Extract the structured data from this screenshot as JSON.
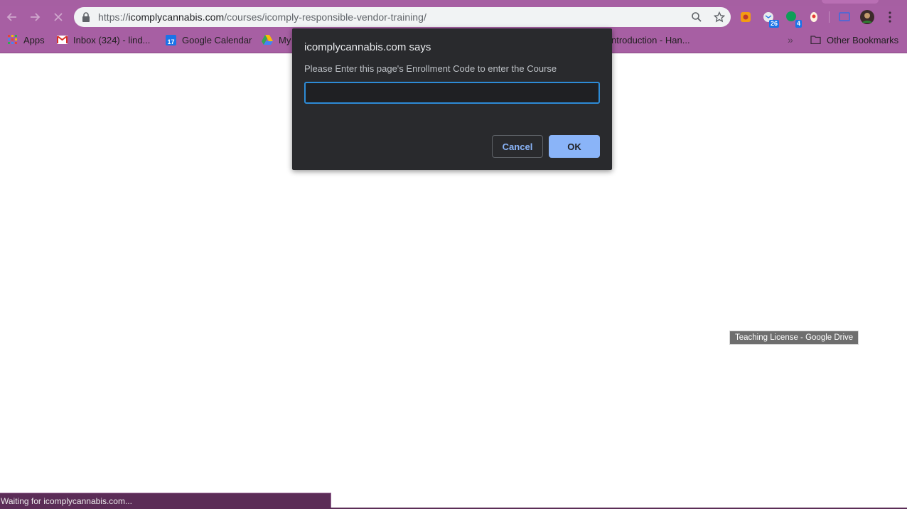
{
  "browser": {
    "url_scheme": "https://",
    "url_host": "icomplycannabis.com",
    "url_path": "/courses/icomply-responsible-vendor-training/",
    "extensions": [
      {
        "name": "honey-extension-icon",
        "badge": ""
      },
      {
        "name": "mail-extension-icon",
        "badge": "26"
      },
      {
        "name": "chat-extension-icon",
        "badge": "4"
      },
      {
        "name": "pin-extension-icon",
        "badge": ""
      }
    ]
  },
  "bookmarks": {
    "apps": "Apps",
    "gmail": "Inbox (324) - lind...",
    "calendar": "Google Calendar",
    "calendar_day": "17",
    "drive": "My",
    "hidden": "ntroduction - Han...",
    "overflow": "»",
    "other": "Other Bookmarks"
  },
  "dialog": {
    "title": "icomplycannabis.com says",
    "message": "Please Enter this page's Enrollment Code to enter the Course",
    "input_value": "",
    "cancel_label": "Cancel",
    "ok_label": "OK"
  },
  "tooltip": "Teaching License - Google Drive",
  "status": "Waiting for icomplycannabis.com...",
  "colors": {
    "chrome_frame": "#a75fa3",
    "dialog_bg": "#292a2d",
    "accent": "#8ab4f8",
    "status_bg": "#5b2d57"
  }
}
